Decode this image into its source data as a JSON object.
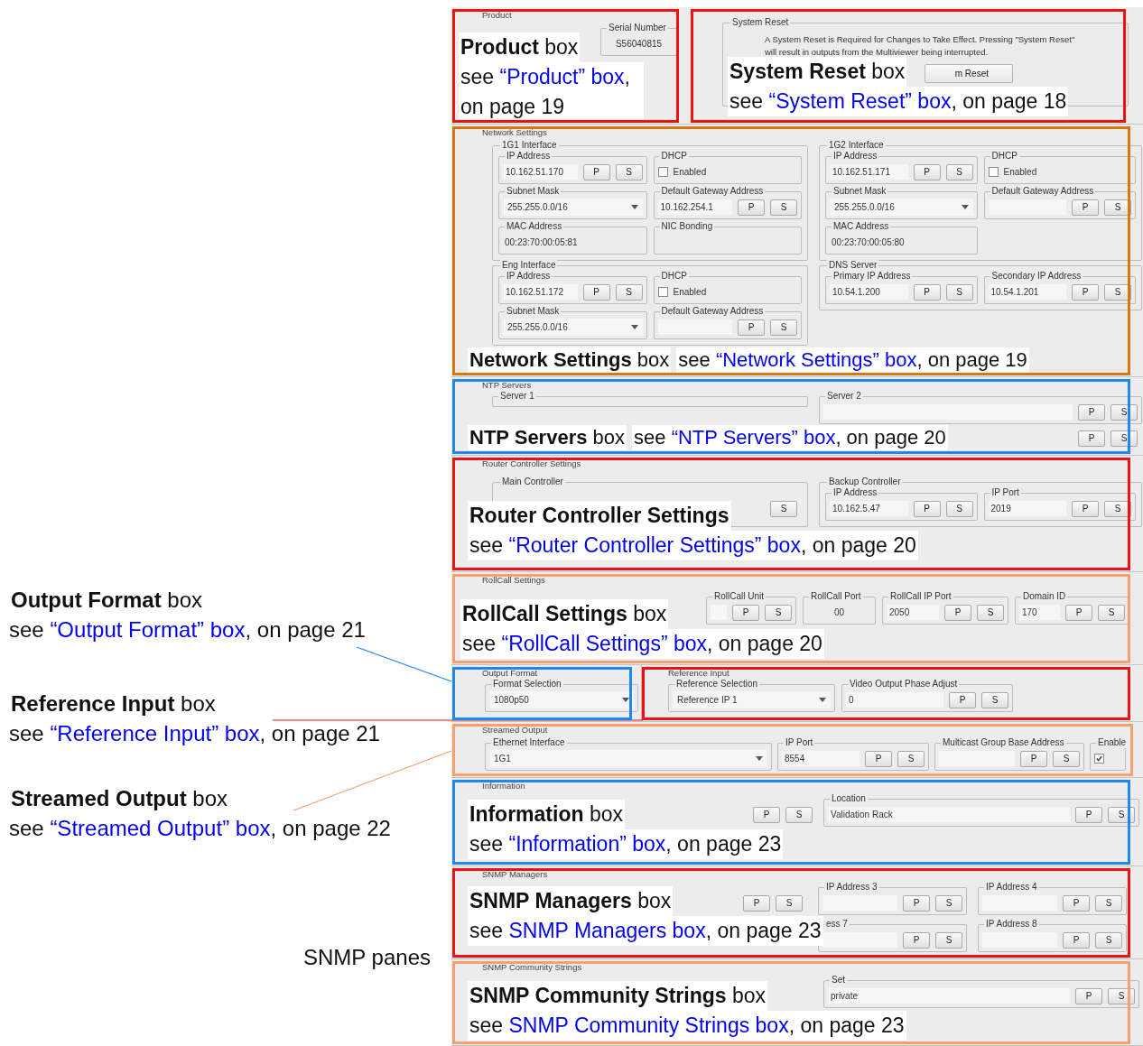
{
  "side_notes": [
    {
      "heading": "**Output Format** box",
      "see": "see ",
      "link": "“Output Format” box",
      "rest": ", on page 21"
    },
    {
      "heading": "**Reference Input** box",
      "see": "see ",
      "link": "“Reference Input” box",
      "rest": ", on page 21"
    },
    {
      "heading": "**Streamed Output** box",
      "see": "see ",
      "link": "“Streamed Output” box",
      "rest": ", on page 22"
    }
  ],
  "panes_label": "SNMP panes",
  "sections": [
    {
      "legend": "Product",
      "callout": {
        "color": "#ee1111",
        "heading": "**Product** box",
        "see": "see ",
        "link": "“Product” box",
        "rest": ", on page 19"
      },
      "groups": [
        {
          "fields": [
            {
              "kind": "display",
              "label": "Serial Number",
              "value": "S56040815"
            }
          ]
        }
      ]
    },
    {
      "callout": {
        "color": "#ee1111",
        "heading": "**System Reset** box",
        "see": "see ",
        "link": "“System Reset” box",
        "rest": ", on page 18"
      },
      "groups": [
        {
          "legend": "System Reset",
          "fields": [
            {
              "kind": "note",
              "value": "A System Reset is Required for Changes to Take Effect. Pressing \"System Reset\"\nwill result in outputs from the Multiviewer being interrupted."
            },
            {
              "kind": "button",
              "value": "m Reset"
            }
          ]
        }
      ]
    },
    {
      "legend": "Network Settings",
      "callout": {
        "color": "#d4790a",
        "heading": "**Network Settings** box",
        "see": "see ",
        "link": "“Network Settings” box",
        "rest": ", on page 19"
      },
      "groups": [
        {
          "legend": "1G1 Interface",
          "fields": [
            {
              "kind": "entry",
              "label": "IP Address",
              "value": "10.162.51.170",
              "buttons": [
                "P",
                "S"
              ]
            },
            {
              "kind": "check",
              "label": "DHCP",
              "text": "Enabled",
              "checked": false
            },
            {
              "kind": "combo",
              "label": "Subnet Mask",
              "value": "255.255.0.0/16"
            },
            {
              "kind": "entry",
              "label": "Default Gateway Address",
              "value": "10.162.254.1",
              "buttons": [
                "P",
                "S"
              ]
            },
            {
              "kind": "display",
              "label": "MAC Address",
              "value": "00:23:70:00:05:81"
            },
            {
              "kind": "display",
              "label": "NIC Bonding"
            }
          ]
        },
        {
          "legend": "1G2 Interface",
          "fields": [
            {
              "kind": "entry",
              "label": "IP Address",
              "value": "10.162.51.171",
              "buttons": [
                "P",
                "S"
              ]
            },
            {
              "kind": "check",
              "label": "DHCP",
              "text": "Enabled",
              "checked": false
            },
            {
              "kind": "combo",
              "label": "Subnet Mask",
              "value": "255.255.0.0/16"
            },
            {
              "kind": "entry",
              "label": "Default Gateway Address",
              "buttons": [
                "P",
                "S"
              ]
            },
            {
              "kind": "display",
              "label": "MAC Address",
              "value": "00:23:70:00:05:80"
            }
          ]
        },
        {
          "legend": "Eng Interface",
          "fields": [
            {
              "kind": "entry",
              "label": "IP Address",
              "value": "10.162.51.172",
              "buttons": [
                "P",
                "S"
              ]
            },
            {
              "kind": "check",
              "label": "DHCP",
              "text": "Enabled",
              "checked": false
            },
            {
              "kind": "combo",
              "label": "Subnet Mask",
              "value": "255.255.0.0/16"
            },
            {
              "kind": "entry",
              "label": "Default Gateway Address",
              "buttons": [
                "P",
                "S"
              ]
            }
          ]
        },
        {
          "legend": "DNS Server",
          "fields": [
            {
              "kind": "entry",
              "label": "Primary IP Address",
              "value": "10.54.1.200",
              "buttons": [
                "P",
                "S"
              ]
            },
            {
              "kind": "entry",
              "label": "Secondary IP Address",
              "value": "10.54.1.201",
              "buttons": [
                "P",
                "S"
              ]
            }
          ]
        }
      ]
    },
    {
      "legend": "NTP Servers",
      "callout": {
        "color": "#1e88f0",
        "heading": "**NTP Servers** box",
        "see": "see ",
        "link": "“NTP Servers” box",
        "rest": ", on page 20"
      },
      "groups": [
        {
          "fields": [
            {
              "kind": "entry",
              "label": "Server 1"
            }
          ]
        },
        {
          "fields": [
            {
              "kind": "entry",
              "label": "Server 2",
              "buttons": [
                "P",
                "S"
              ]
            },
            {
              "kind": "entry",
              "buttons": [
                "P",
                "S"
              ]
            }
          ]
        }
      ]
    },
    {
      "legend": "Router Controller Settings",
      "callout": {
        "color": "#ee1111",
        "heading": "**Router Controller Settings**",
        "see": "see ",
        "link": "“Router Controller Settings” box",
        "rest": ", on page 20"
      },
      "groups": [
        {
          "legend": "Main Controller",
          "fields": [
            {
              "kind": "entry"
            },
            {
              "kind": "entry",
              "buttons": [
                "S"
              ]
            }
          ]
        },
        {
          "legend": "Backup Controller",
          "fields": [
            {
              "kind": "entry",
              "label": "IP Address",
              "value": "10.162.5.47",
              "buttons": [
                "P",
                "S"
              ]
            },
            {
              "kind": "entry",
              "label": "IP Port",
              "value": "2019",
              "buttons": [
                "P",
                "S"
              ]
            }
          ]
        }
      ]
    },
    {
      "legend": "RollCall Settings",
      "callout": {
        "color": "#f5a06e",
        "heading": "**RollCall Settings** box",
        "see": "see ",
        "link": "“RollCall Settings” box",
        "rest": ", on page 20"
      },
      "groups": [
        {
          "fields": [
            {
              "kind": "entry"
            },
            {
              "kind": "entry",
              "label": "RollCall Unit",
              "buttons": [
                "P",
                "S"
              ]
            },
            {
              "kind": "display",
              "label": "RollCall Port",
              "value": "00"
            },
            {
              "kind": "entry",
              "label": "RollCall IP Port",
              "value": "2050",
              "buttons": [
                "P",
                "S"
              ]
            },
            {
              "kind": "entry",
              "label": "Domain ID",
              "value": "170",
              "buttons": [
                "P",
                "S"
              ]
            }
          ]
        }
      ]
    },
    {
      "legend": "Output Format",
      "callout": {
        "color": "#1e88f0"
      },
      "groups": [
        {
          "fields": [
            {
              "kind": "combo",
              "label": "Format Selection",
              "value": "1080p50"
            }
          ]
        }
      ]
    },
    {
      "legend": "Reference Input",
      "callout": {
        "color": "#ee1111"
      },
      "groups": [
        {
          "fields": [
            {
              "kind": "combo",
              "label": "Reference Selection",
              "value": "Reference IP 1"
            },
            {
              "kind": "entry",
              "label": "Video Output Phase Adjust",
              "value": "0",
              "buttons": [
                "P",
                "S"
              ]
            }
          ]
        }
      ]
    },
    {
      "legend": "Streamed Output",
      "callout": {
        "color": "#f5a06e"
      },
      "groups": [
        {
          "fields": [
            {
              "kind": "combo",
              "label": "Ethernet Interface",
              "value": "1G1"
            },
            {
              "kind": "entry",
              "label": "IP Port",
              "value": "8554",
              "buttons": [
                "P",
                "S"
              ]
            },
            {
              "kind": "entry",
              "label": "Multicast Group Base Address",
              "buttons": [
                "P",
                "S"
              ]
            },
            {
              "kind": "check",
              "label": "Enable",
              "checked": true
            }
          ]
        }
      ]
    },
    {
      "legend": "Information",
      "callout": {
        "color": "#1e88f0",
        "heading": "**Information** box",
        "see": "see ",
        "link": "“Information” box",
        "rest": ", on page 23"
      },
      "groups": [
        {
          "fields": [
            {
              "kind": "entry",
              "buttons": [
                "P",
                "S"
              ]
            },
            {
              "kind": "entry",
              "label": "Location",
              "value": "Validation Rack",
              "buttons": [
                "P",
                "S"
              ]
            }
          ]
        }
      ]
    },
    {
      "legend": "SNMP Managers",
      "callout": {
        "color": "#ee1111",
        "heading": "**SNMP Managers** box",
        "see": "see ",
        "link": "SNMP Managers box",
        "rest": ", on page 23"
      },
      "groups": [
        {
          "fields": [
            {
              "kind": "entry"
            },
            {
              "kind": "entry",
              "buttons": [
                "P",
                "S"
              ]
            },
            {
              "kind": "entry",
              "label": "IP Address 3",
              "buttons": [
                "P",
                "S"
              ]
            },
            {
              "kind": "entry",
              "label": "IP Address 4",
              "buttons": [
                "P",
                "S"
              ]
            },
            {
              "kind": "entry"
            },
            {
              "kind": "entry"
            },
            {
              "kind": "entry",
              "label": "ess 7",
              "buttons": [
                "P",
                "S"
              ]
            },
            {
              "kind": "entry",
              "label": "IP Address 8",
              "buttons": [
                "P",
                "S"
              ]
            }
          ]
        }
      ]
    },
    {
      "legend": "SNMP Community Strings",
      "callout": {
        "color": "#f5a06e",
        "heading": "**SNMP Community Strings** box",
        "see": "see ",
        "link": "SNMP Community Strings box",
        "rest": ", on page 23"
      },
      "groups": [
        {
          "fields": [
            {
              "kind": "entry"
            },
            {
              "kind": "entry",
              "label": "Set",
              "value": "private",
              "buttons": [
                "P",
                "S"
              ]
            }
          ]
        }
      ]
    }
  ]
}
